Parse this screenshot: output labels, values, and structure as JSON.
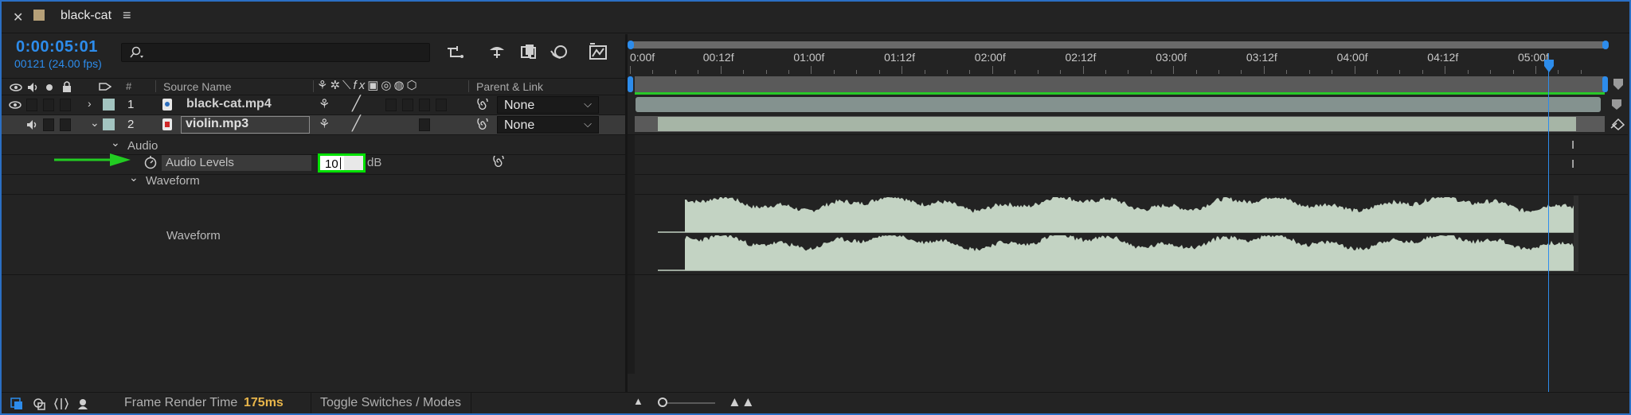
{
  "tab": {
    "title": "black-cat"
  },
  "timecode": {
    "main": "0:00:05:01",
    "frames": "00121 (24.00 fps)"
  },
  "search": {
    "placeholder": ""
  },
  "headers": {
    "num": "#",
    "source": "Source Name",
    "parent": "Parent & Link"
  },
  "layers": [
    {
      "num": "1",
      "name": "black-cat.mp4",
      "parent": "None",
      "color": "#a3c4c0"
    },
    {
      "num": "2",
      "name": "violin.mp3",
      "parent": "None",
      "color": "#a3c4c0"
    }
  ],
  "properties": {
    "audio": "Audio",
    "audio_levels": "Audio Levels",
    "audio_levels_value": "10",
    "audio_levels_unit": "dB",
    "waveform_group": "Waveform",
    "waveform_label": "Waveform"
  },
  "ruler": {
    "ticks": [
      "0:00f",
      "00:12f",
      "01:00f",
      "01:12f",
      "02:00f",
      "02:12f",
      "03:00f",
      "03:12f",
      "04:00f",
      "04:12f",
      "05:00f"
    ]
  },
  "status": {
    "frame_render_label": "Frame Render Time",
    "frame_render_value": "175ms",
    "toggle": "Toggle Switches / Modes"
  },
  "colors": {
    "accent": "#2d8ceb",
    "highlight": "#00e000",
    "arrow": "#22cc22",
    "waveform": "#c3d3c3",
    "render_time": "#e8b54a"
  }
}
